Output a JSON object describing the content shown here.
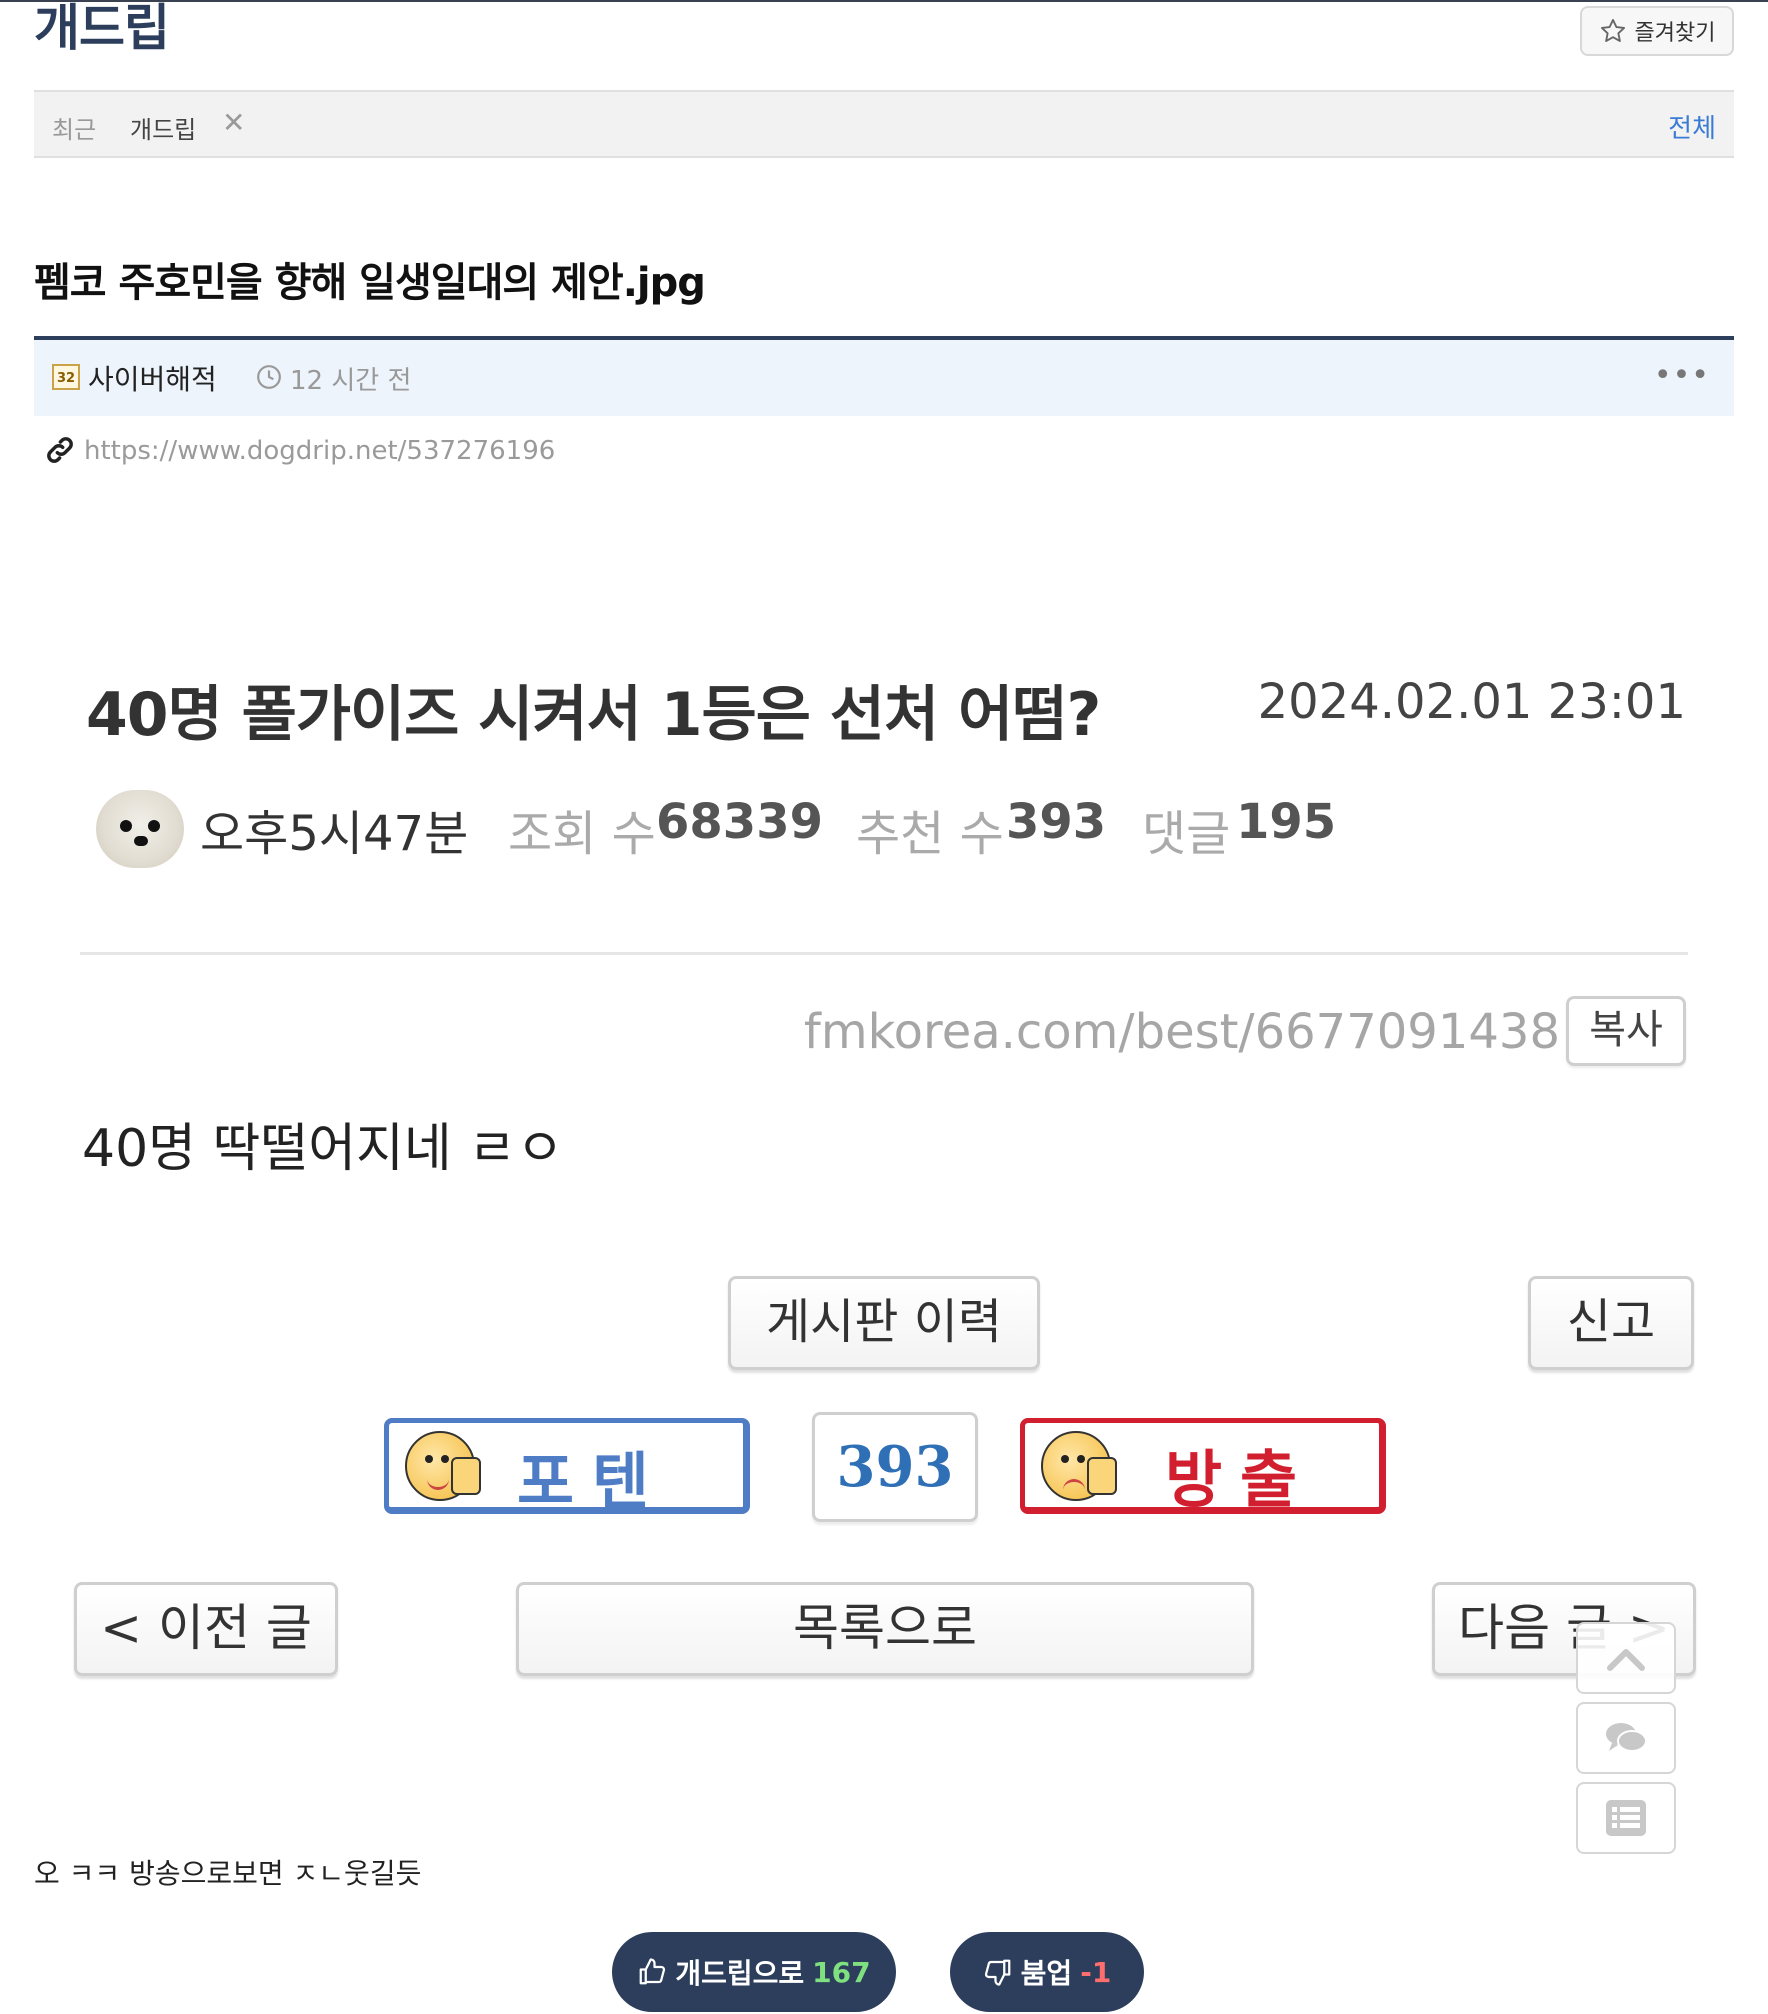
{
  "header": {
    "board_title": "개드립",
    "favorite_label": "즐겨찾기",
    "favorite_icon": "star-outline-icon"
  },
  "recent": {
    "label": "최근",
    "tab": "개드립",
    "close_icon": "close-icon",
    "all_label": "전체",
    "accent_color": "#3a7bd5"
  },
  "post": {
    "title": "펨코 주호민을 향해 일생일대의 제안.jpg",
    "level_badge": "32",
    "author": "사이버해적",
    "time_ago": "12 시간 전",
    "more_label": "•••",
    "url": "https://www.dogdrip.net/537276196",
    "theme_color": "#2d3e5c"
  },
  "screenshot": {
    "title": "40명 폴가이즈 시켜서 1등은 선처 어떰?",
    "date": "2024.02.01 23:01",
    "nickname": "오후5시47분",
    "views_label": "조회 수",
    "views": "68339",
    "recommend_label": "추천 수",
    "recommend": "393",
    "comments_label": "댓글",
    "comments": "195",
    "source_url": "fmkorea.com/best/6677091438",
    "copy_label": "복사",
    "body": "40명 딱떨어지네 ㄹㅇ",
    "history_label": "게시판 이력",
    "report_label": "신고",
    "potten_label": "포텐",
    "vote_count": "393",
    "ban_label": "방출",
    "prev_label": "< 이전 글",
    "list_label": "목록으로",
    "next_label": "다음 글 >"
  },
  "floating": {
    "top_icon": "chevron-up-icon",
    "comments_icon": "chat-bubbles-icon",
    "list_icon": "list-icon"
  },
  "comment_text": "오 ㅋㅋ 방송으로보면 ㅈㄴ웃길듯",
  "votes": {
    "up_label": "개드립으로",
    "up_count": "167",
    "down_label": "붐업",
    "down_count": "-1"
  }
}
